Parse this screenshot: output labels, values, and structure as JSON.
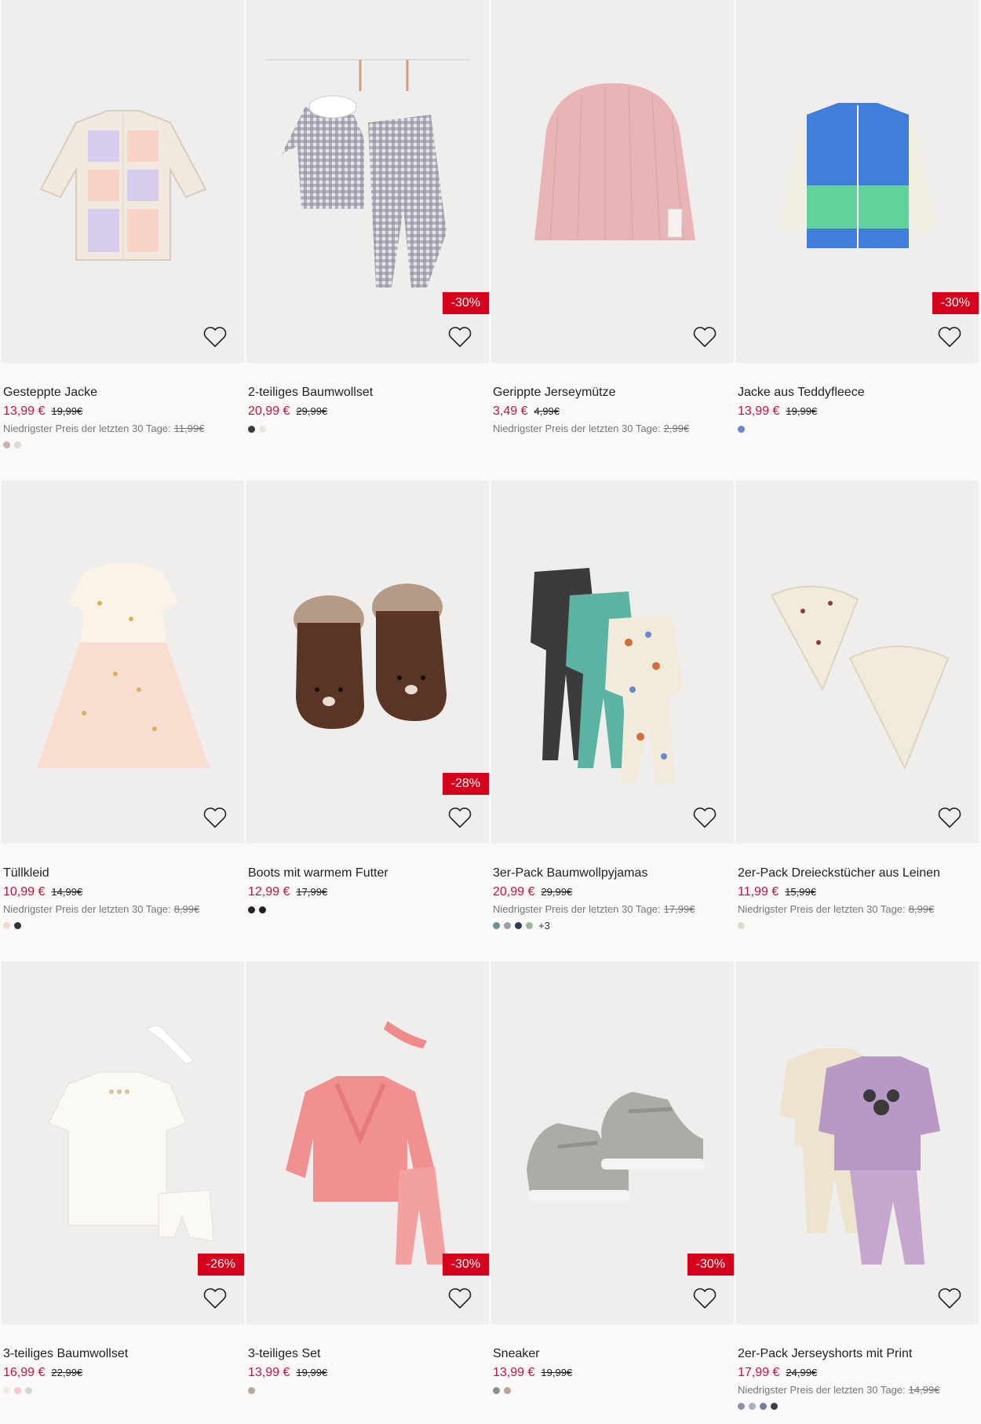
{
  "products": [
    {
      "name": "Gesteppte Jacke",
      "price": "13,99 €",
      "old_price": "19,99€",
      "lowest_label": "Niedrigster Preis der letzten 30 Tage:",
      "lowest_price": "11,99€",
      "badge": "",
      "icon": "quilted-jacket-icon",
      "swatches": [
        "#c9b5a6",
        "#e3d8cf"
      ],
      "more": ""
    },
    {
      "name": "2-teiliges Baumwollset",
      "price": "20,99 €",
      "old_price": "29,99€",
      "lowest_label": "",
      "lowest_price": "",
      "badge": "-30%",
      "icon": "gingham-set-icon",
      "swatches": [
        "#3a3a3a",
        "#ece7dc"
      ],
      "more": ""
    },
    {
      "name": "Gerippte Jerseymütze",
      "price": "3,49 €",
      "old_price": "4,99€",
      "lowest_label": "Niedrigster Preis der letzten 30 Tage:",
      "lowest_price": "2,99€",
      "badge": "",
      "icon": "beanie-icon",
      "swatches": [],
      "more": ""
    },
    {
      "name": "Jacke aus Teddyfleece",
      "price": "13,99 €",
      "old_price": "19,99€",
      "lowest_label": "",
      "lowest_price": "",
      "badge": "-30%",
      "icon": "fleece-vest-icon",
      "swatches": [
        "#6b86c9"
      ],
      "more": ""
    },
    {
      "name": "Tüllkleid",
      "price": "10,99 €",
      "old_price": "14,99€",
      "lowest_label": "Niedrigster Preis der letzten 30 Tage:",
      "lowest_price": "8,99€",
      "badge": "",
      "icon": "tulle-dress-icon",
      "swatches": [
        "#f3d9c9",
        "#333333"
      ],
      "more": ""
    },
    {
      "name": "Boots mit warmem Futter",
      "price": "12,99 €",
      "old_price": "17,99€",
      "lowest_label": "",
      "lowest_price": "",
      "badge": "-28%",
      "icon": "boots-icon",
      "swatches": [
        "#2a2220",
        "#1f1f1f"
      ],
      "more": ""
    },
    {
      "name": "3er-Pack Baumwollpyjamas",
      "price": "20,99 €",
      "old_price": "29,99€",
      "lowest_label": "Niedrigster Preis der letzten 30 Tage:",
      "lowest_price": "17,99€",
      "badge": "",
      "icon": "pyjamas-icon",
      "swatches": [
        "#6f8d96",
        "#9aa0a8",
        "#2f3b56",
        "#9eb79a"
      ],
      "more": "+3"
    },
    {
      "name": "2er-Pack Dreieckstücher aus Leinen",
      "price": "11,99 €",
      "old_price": "15,99€",
      "lowest_label": "Niedrigster Preis der letzten 30 Tage:",
      "lowest_price": "8,99€",
      "badge": "",
      "icon": "bandana-bib-icon",
      "swatches": [
        "#dcdcc8"
      ],
      "more": ""
    },
    {
      "name": "3-teiliges Baumwollset",
      "price": "16,99 €",
      "old_price": "22,99€",
      "lowest_label": "",
      "lowest_price": "",
      "badge": "-26%",
      "icon": "white-dress-set-icon",
      "swatches": [
        "#f4ede6",
        "#f2c9cf",
        "#cfdcd6"
      ],
      "more": ""
    },
    {
      "name": "3-teiliges Set",
      "price": "13,99 €",
      "old_price": "19,99€",
      "lowest_label": "",
      "lowest_price": "",
      "badge": "-30%",
      "icon": "pink-sweater-set-icon",
      "swatches": [
        "#b3a89a"
      ],
      "more": ""
    },
    {
      "name": "Sneaker",
      "price": "13,99 €",
      "old_price": "19,99€",
      "lowest_label": "",
      "lowest_price": "",
      "badge": "-30%",
      "icon": "sneaker-icon",
      "swatches": [
        "#8e8f8a",
        "#b8a898"
      ],
      "more": ""
    },
    {
      "name": "2er-Pack Jerseyshorts mit Print",
      "price": "17,99 €",
      "old_price": "24,99€",
      "lowest_label": "Niedrigster Preis der letzten 30 Tage:",
      "lowest_price": "14,99€",
      "badge": "",
      "icon": "minnie-set-icon",
      "swatches": [
        "#8a90a8",
        "#a9b0c4",
        "#6f7ea1",
        "#3c3f4f"
      ],
      "more": ""
    }
  ],
  "colors": {
    "sale_price": "#c4123f",
    "badge_bg": "#d6001c",
    "image_bg": "#efeeec",
    "page_bg": "#faf9f8"
  }
}
